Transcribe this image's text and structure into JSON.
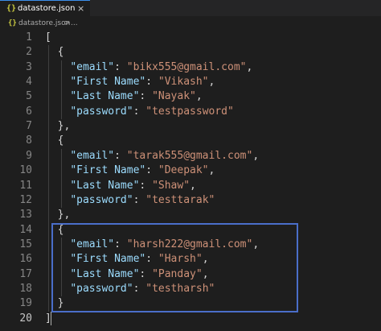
{
  "tab": {
    "icon": "{}",
    "title": "datastore.json",
    "close": "×"
  },
  "breadcrumb": {
    "icon": "{}",
    "file": "datastore.json",
    "separator": ">",
    "more": "..."
  },
  "editor": {
    "line_numbers": [
      "1",
      "2",
      "3",
      "4",
      "5",
      "6",
      "7",
      "8",
      "9",
      "10",
      "11",
      "12",
      "13",
      "14",
      "15",
      "16",
      "17",
      "18",
      "19",
      "20"
    ],
    "lines": [
      "[",
      "  {",
      "    \"email\": \"bikx555@gmail.com\",",
      "    \"First Name\": \"Vikash\",",
      "    \"Last Name\": \"Nayak\",",
      "    \"password\": \"testpassword\"",
      "  },",
      "  {",
      "    \"email\": \"tarak555@gmail.com\",",
      "    \"First Name\": \"Deepak\",",
      "    \"Last Name\": \"Shaw\",",
      "    \"password\": \"testtarak\"",
      "  },",
      "  {",
      "    \"email\": \"harsh222@gmail.com\",",
      "    \"First Name\": \"Harsh\",",
      "    \"Last Name\": \"Panday\",",
      "    \"password\": \"testharsh\"",
      "  }",
      "]"
    ]
  },
  "colors": {
    "background": "#1e1e1e",
    "key": "#9cdcfe",
    "string": "#ce9178",
    "punctuation": "#d4d4d4",
    "line_number": "#858585",
    "highlight_box": "#4a6ec9"
  },
  "icons": {
    "file_type": "json-braces-icon",
    "close": "close-icon"
  }
}
